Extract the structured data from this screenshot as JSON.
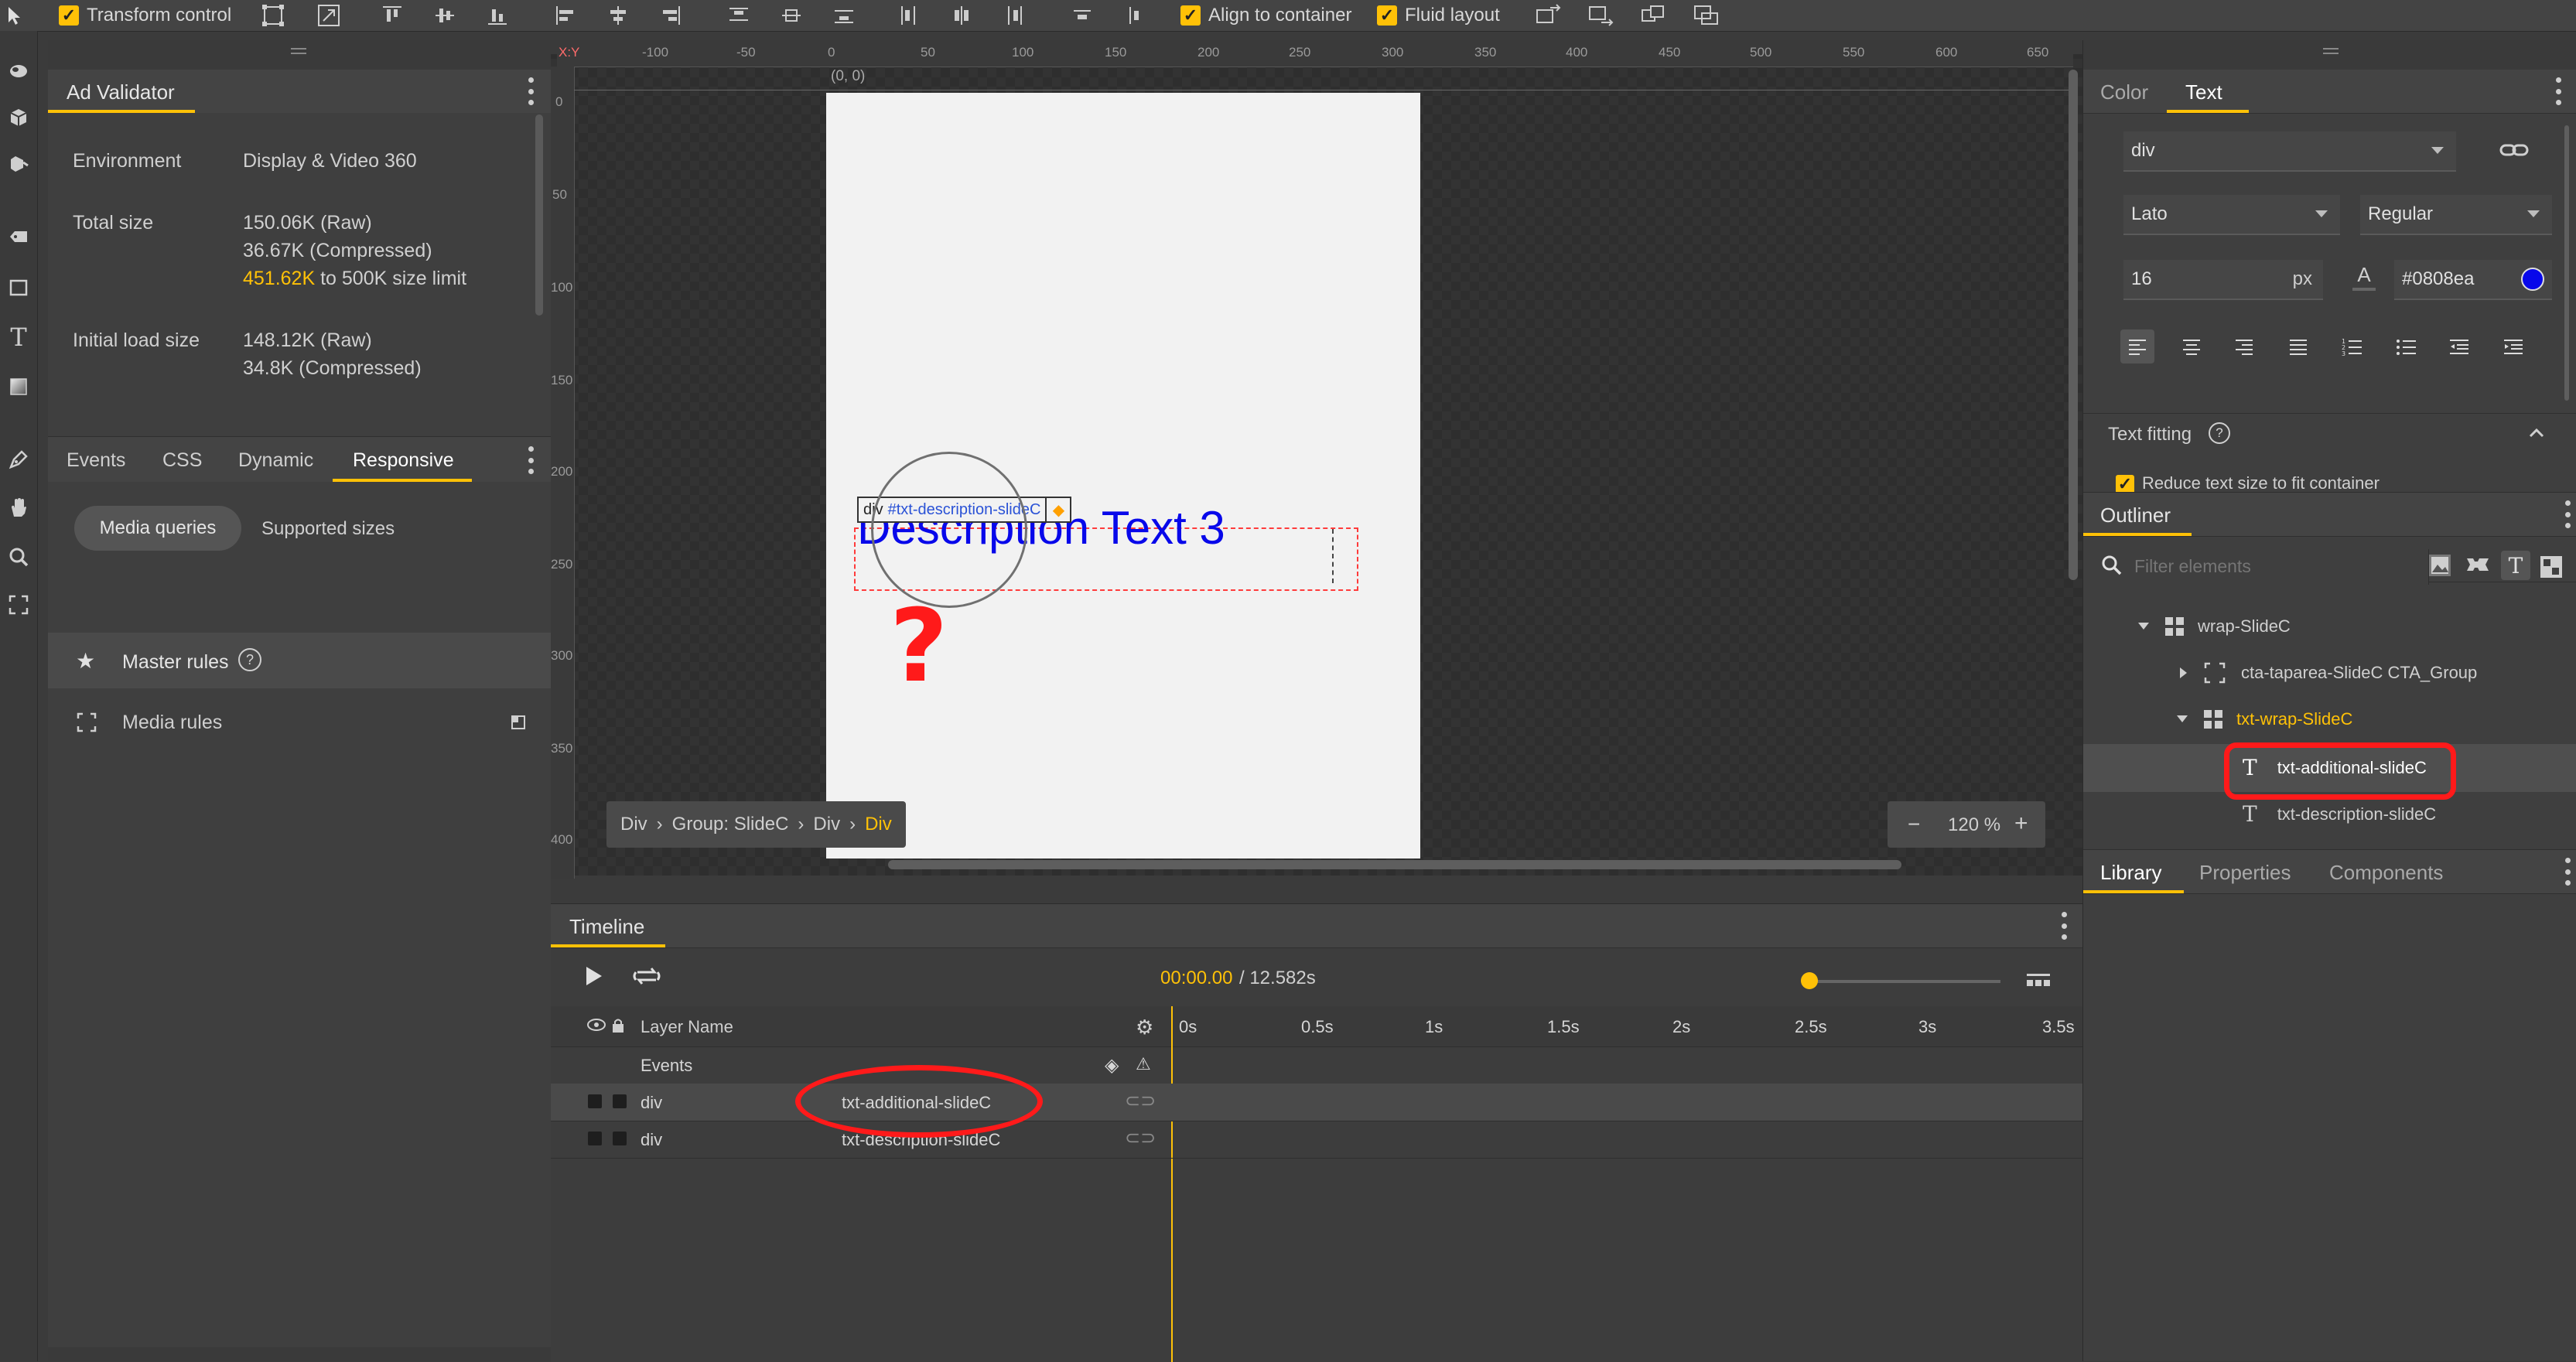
{
  "toolbar": {
    "transform_control": "Transform control",
    "align_to_container": "Align to container",
    "fluid_layout": "Fluid layout"
  },
  "left_panel": {
    "title": "Ad Validator",
    "environment_label": "Environment",
    "environment_value": "Display & Video 360",
    "total_size_label": "Total size",
    "total_raw": "150.06K (Raw)",
    "total_compressed": "36.67K (Compressed)",
    "size_limit_value": "451.62K",
    "size_limit_text": "to 500K size limit",
    "initial_load_label": "Initial load size",
    "initial_raw": "148.12K (Raw)",
    "initial_compressed": "34.8K (Compressed)",
    "tabs": [
      {
        "label": "Events"
      },
      {
        "label": "CSS"
      },
      {
        "label": "Dynamic"
      },
      {
        "label": "Responsive"
      }
    ],
    "subtabs": [
      "Media queries",
      "Supported sizes"
    ],
    "master_rules": "Master rules",
    "media_rules": "Media rules"
  },
  "canvas": {
    "origin": "(0, 0)",
    "ruler_top": [
      "-100",
      "-50",
      "0",
      "50",
      "100",
      "150",
      "200",
      "250",
      "300",
      "350",
      "400",
      "450",
      "500",
      "550",
      "600",
      "650"
    ],
    "ruler_left": [
      "0",
      "50",
      "100",
      "150",
      "200",
      "250",
      "300",
      "350",
      "400"
    ],
    "element_tag": "div",
    "element_id": "#txt-description-slideC",
    "description_text": "Description Text 3",
    "annotation": "?",
    "breadcrumb": [
      "Div",
      "Group: SlideC",
      "Div",
      "Div"
    ],
    "zoom": "120 %",
    "zoom_minus": "−",
    "zoom_plus": "+"
  },
  "timeline": {
    "title": "Timeline",
    "current_time": "00:00.00",
    "total_time": "/ 12.582s",
    "layer_name_header": "Layer Name",
    "events_label": "Events",
    "time_marks": [
      "0s",
      "0.5s",
      "1s",
      "1.5s",
      "2s",
      "2.5s",
      "3s",
      "3.5s"
    ],
    "layers": [
      {
        "type": "div",
        "name": "txt-additional-slideC"
      },
      {
        "type": "div",
        "name": "txt-description-slideC"
      }
    ]
  },
  "right_panel": {
    "tabs": [
      "Color",
      "Text"
    ],
    "element_select": "div",
    "font_family": "Lato",
    "font_weight": "Regular",
    "font_size": "16",
    "font_unit": "px",
    "font_color_hex": "#0808ea",
    "font_color_swatch": "#0808ea",
    "text_fitting_title": "Text fitting",
    "reduce_text_label": "Reduce text size to fit container",
    "outliner_title": "Outliner",
    "filter_placeholder": "Filter elements",
    "outliner_items": [
      {
        "name": "wrap-SlideC"
      },
      {
        "name": "cta-taparea-SlideC CTA_Group"
      },
      {
        "name": "txt-wrap-SlideC"
      },
      {
        "name": "txt-additional-slideC"
      },
      {
        "name": "txt-description-slideC"
      }
    ],
    "bottom_tabs": [
      "Library",
      "Properties",
      "Components"
    ]
  },
  "colors": {
    "accent": "#ffc107",
    "annotation_red": "#ff1a1a",
    "text_blue": "#0808ea"
  }
}
